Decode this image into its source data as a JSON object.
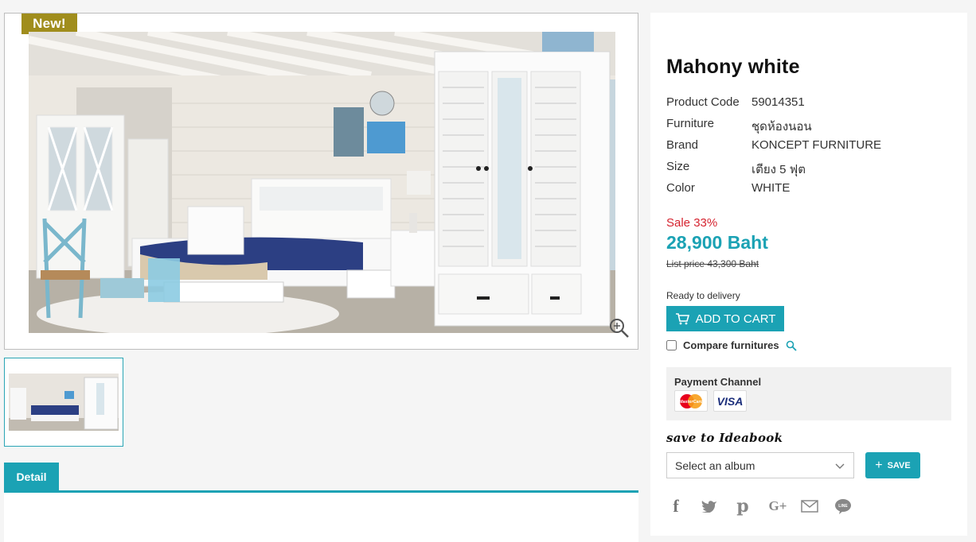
{
  "gallery": {
    "badge": "New!",
    "main_image_alt": "bedroom-set-photo",
    "zoom_icon": "zoom-icon",
    "thumbnail_icon": "thumbnail-image"
  },
  "tabs": [
    {
      "label": "Detail"
    }
  ],
  "product": {
    "title": "Mahony white",
    "specs": [
      {
        "label": "Product Code",
        "value": "59014351"
      },
      {
        "label": "Furniture",
        "value": "ชุดห้องนอน"
      },
      {
        "label": "Brand",
        "value": "KONCEPT FURNITURE"
      },
      {
        "label": "Size",
        "value": "เตียง 5 ฟุต"
      },
      {
        "label": "Color",
        "value": "WHITE"
      }
    ],
    "sale": "Sale 33%",
    "price": "28,900 Baht",
    "list_price": "List price 43,300 Baht",
    "availability": "Ready to delivery",
    "add_to_cart": "ADD TO CART",
    "compare_label": "Compare furnitures"
  },
  "payment": {
    "title": "Payment Channel",
    "cards": [
      {
        "name": "mastercard-icon",
        "label": "MasterCard"
      },
      {
        "name": "visa-icon",
        "label": "VISA"
      }
    ]
  },
  "ideabook": {
    "title": "save to Ideabook",
    "select_value": "Select an album",
    "save_label": "SAVE"
  },
  "share": {
    "icons": [
      "facebook-icon",
      "twitter-icon",
      "pinterest-icon",
      "google-plus-icon",
      "email-icon",
      "line-icon"
    ]
  },
  "colors": {
    "accent": "#1ba2b4",
    "badge": "#a08d1c",
    "sale": "#d5232f"
  }
}
